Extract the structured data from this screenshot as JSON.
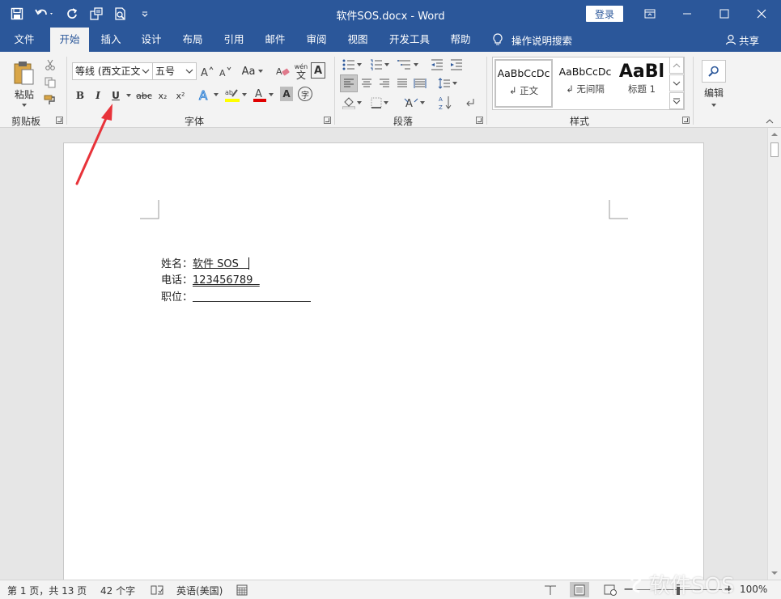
{
  "titlebar": {
    "title": "软件SOS.docx  -  Word",
    "login_label": "登录"
  },
  "tabs": [
    {
      "label": "文件"
    },
    {
      "label": "开始"
    },
    {
      "label": "插入"
    },
    {
      "label": "设计"
    },
    {
      "label": "布局"
    },
    {
      "label": "引用"
    },
    {
      "label": "邮件"
    },
    {
      "label": "审阅"
    },
    {
      "label": "视图"
    },
    {
      "label": "开发工具"
    },
    {
      "label": "帮助"
    }
  ],
  "tellme_label": "操作说明搜索",
  "share_label": "共享",
  "clipboard": {
    "paste_label": "粘贴",
    "group_label": "剪贴板"
  },
  "font": {
    "font_name": "等线 (西文正文",
    "font_size": "五号",
    "change_case": "Aa",
    "phonetic": "wén",
    "group_label": "字体",
    "bold": "B",
    "italic": "I",
    "underline": "U",
    "strike": "abc",
    "subscript": "x₂",
    "superscript": "x²",
    "char_shade": "A",
    "circle": "字"
  },
  "paragraph": {
    "group_label": "段落"
  },
  "styles": {
    "group_label": "样式",
    "items": [
      {
        "sample": "AaBbCcDc",
        "name": "↲ 正文"
      },
      {
        "sample": "AaBbCcDc",
        "name": "↲ 无间隔"
      },
      {
        "sample": "AaBl",
        "name": "标题 1"
      }
    ]
  },
  "editing": {
    "label": "编辑"
  },
  "document": {
    "lines": [
      {
        "label": "姓名：",
        "value": "软件 SOS   "
      },
      {
        "label": "电话：",
        "value": "123456789  "
      },
      {
        "label": "职位：",
        "value": ""
      }
    ]
  },
  "statusbar": {
    "page": "第 1 页，共 13 页",
    "words": "42 个字",
    "language": "英语(美国)",
    "zoom": "100%"
  },
  "watermark": "软件SOS",
  "colors": {
    "word_blue": "#2b579a",
    "highlight": "#ffff00",
    "font_color": "#e00000",
    "arrow": "#e8333a"
  }
}
